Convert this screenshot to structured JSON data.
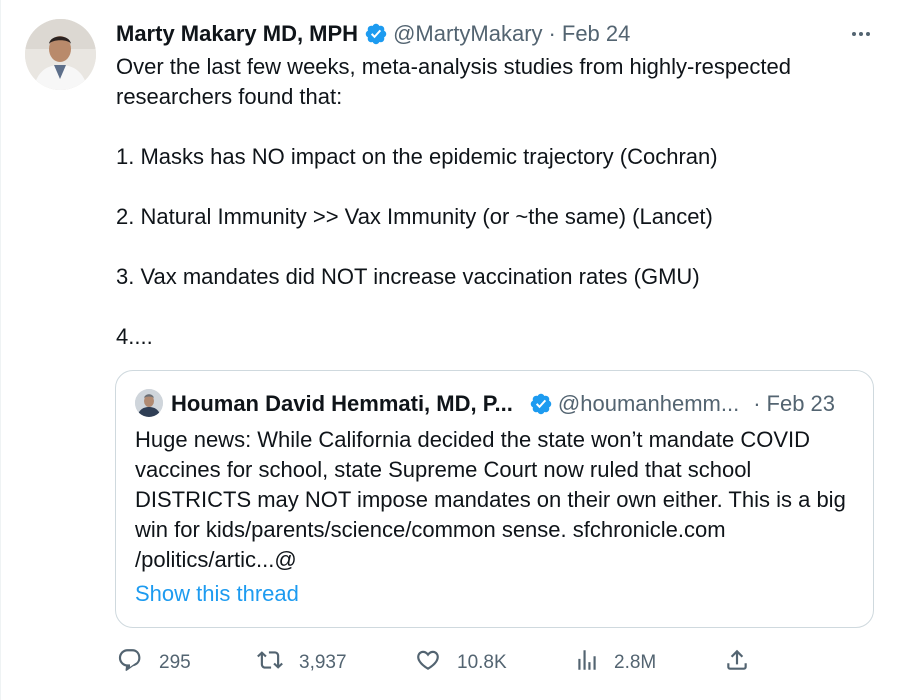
{
  "tweet": {
    "author_name": "Marty Makary MD, MPH",
    "author_handle": "@MartyMakary",
    "separator": "·",
    "date": "Feb 24",
    "text": "Over the last few weeks, meta-analysis studies from highly-respected researchers found that:\n\n1. Masks has NO impact on the epidemic trajectory (Cochran)\n\n2. Natural Immunity >> Vax Immunity (or ~the same) (Lancet)\n\n3. Vax mandates did NOT increase vaccination rates (GMU)\n\n4....",
    "more_icon": "more-horizontal-icon"
  },
  "quoted": {
    "author_name": "Houman David Hemmati, MD, P...",
    "author_handle": "@houmanhemm...",
    "separator": "·",
    "date": "Feb 23",
    "text": "Huge news: While California decided the state won’t mandate COVID vaccines for school, state Supreme Court now ruled that school DISTRICTS may NOT impose mandates on their own either. This is a big win for kids/parents/science/common sense. sfchronicle.com /politics/artic...@",
    "show_thread": "Show this thread"
  },
  "actions": {
    "replies": "295",
    "retweets": "3,937",
    "likes": "10.8K",
    "views": "2.8M"
  },
  "colors": {
    "verified": "#1d9bf0",
    "link": "#1d9bf0",
    "muted": "#536471",
    "text": "#0f1419",
    "border": "#cfd9de"
  }
}
